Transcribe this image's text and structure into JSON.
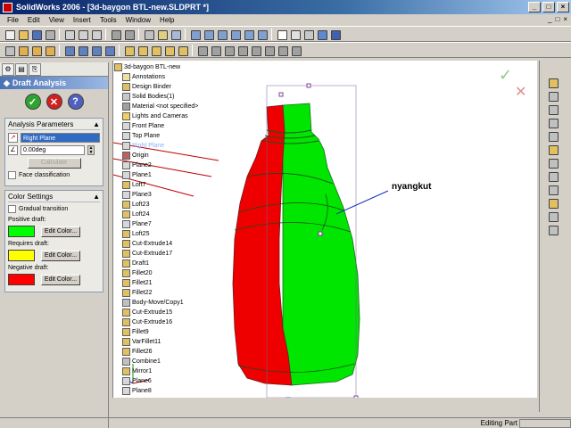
{
  "window": {
    "title": "SolidWorks 2006 - [3d-baygon BTL-new.SLDPRT *]"
  },
  "menu": {
    "items": [
      "File",
      "Edit",
      "View",
      "Insert",
      "Tools",
      "Window",
      "Help"
    ]
  },
  "panel": {
    "title": "Draft Analysis",
    "params_title": "Analysis Parameters",
    "direction_value": "Right Plane",
    "angle_value": "0.00deg",
    "calculate_label": "Calculate",
    "face_classification_label": "Face classification",
    "color_title": "Color Settings",
    "gradual_label": "Gradual transition",
    "positive_label": "Positive draft:",
    "requires_label": "Requires draft:",
    "negative_label": "Negative draft:",
    "edit_color_label": "Edit Color...",
    "colors": {
      "positive": "#00ff00",
      "requires": "#ffff00",
      "negative": "#ff0000"
    }
  },
  "tree": {
    "root": "3d-baygon BTL-new",
    "items": [
      {
        "label": "Annotations",
        "icon": "annotation-icon"
      },
      {
        "label": "Design Binder",
        "icon": "binder-icon"
      },
      {
        "label": "Solid Bodies(1)",
        "icon": "solid-bodies-icon"
      },
      {
        "label": "Material <not specified>",
        "icon": "material-icon"
      },
      {
        "label": "Lights and Cameras",
        "icon": "lights-icon"
      },
      {
        "label": "Front Plane",
        "icon": "plane-icon"
      },
      {
        "label": "Top Plane",
        "icon": "plane-icon"
      },
      {
        "label": "Right Plane",
        "icon": "plane-icon",
        "selected": true
      },
      {
        "label": "Origin",
        "icon": "origin-icon"
      },
      {
        "label": "Plane2",
        "icon": "plane-icon"
      },
      {
        "label": "Plane1",
        "icon": "plane-icon"
      },
      {
        "label": "Loft7",
        "icon": "loft-icon"
      },
      {
        "label": "Plane3",
        "icon": "plane-icon"
      },
      {
        "label": "Loft23",
        "icon": "loft-icon"
      },
      {
        "label": "Loft24",
        "icon": "loft-icon"
      },
      {
        "label": "Plane7",
        "icon": "plane-icon"
      },
      {
        "label": "Loft25",
        "icon": "loft-icon"
      },
      {
        "label": "Cut-Extrude14",
        "icon": "cut-extrude-icon"
      },
      {
        "label": "Cut-Extrude17",
        "icon": "cut-extrude-icon"
      },
      {
        "label": "Draft1",
        "icon": "draft-icon"
      },
      {
        "label": "Fillet20",
        "icon": "fillet-icon"
      },
      {
        "label": "Fillet21",
        "icon": "fillet-icon"
      },
      {
        "label": "Fillet22",
        "icon": "fillet-icon"
      },
      {
        "label": "Body-Move/Copy1",
        "icon": "move-body-icon"
      },
      {
        "label": "Cut-Extrude15",
        "icon": "cut-extrude-icon"
      },
      {
        "label": "Cut-Extrude16",
        "icon": "cut-extrude-icon"
      },
      {
        "label": "Fillet9",
        "icon": "fillet-icon"
      },
      {
        "label": "VarFillet11",
        "icon": "fillet-icon"
      },
      {
        "label": "Fillet26",
        "icon": "fillet-icon"
      },
      {
        "label": "Combine1",
        "icon": "combine-icon"
      },
      {
        "label": "Mirror1",
        "icon": "mirror-icon"
      },
      {
        "label": "Plane6",
        "icon": "plane-icon"
      },
      {
        "label": "Plane8",
        "icon": "plane-icon"
      }
    ]
  },
  "viewport": {
    "annotation": "nyangkut"
  },
  "status": {
    "mode": "Editing Part"
  }
}
